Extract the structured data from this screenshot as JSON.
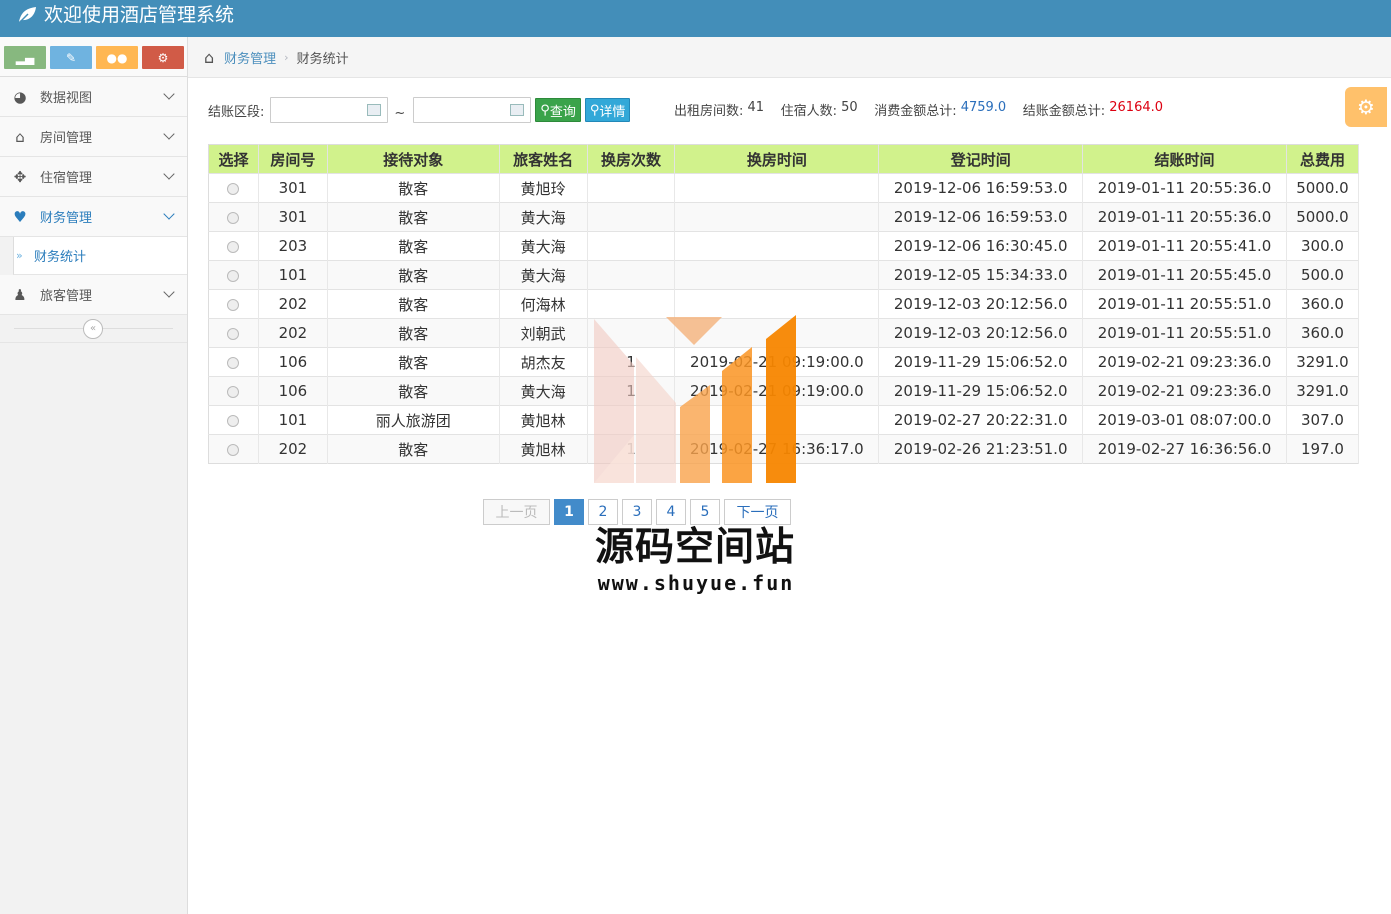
{
  "app": {
    "title": "欢迎使用酒店管理系统"
  },
  "sidebar": {
    "items": [
      {
        "label": "数据视图",
        "icon": "dashboard-icon"
      },
      {
        "label": "房间管理",
        "icon": "home-icon"
      },
      {
        "label": "住宿管理",
        "icon": "move-icon"
      },
      {
        "label": "财务管理",
        "icon": "heart-icon",
        "active": true
      },
      {
        "label": "旅客管理",
        "icon": "user-icon"
      }
    ],
    "sub_item": "财务统计"
  },
  "breadcrumb": {
    "parent": "财务管理",
    "current": "财务统计"
  },
  "filter": {
    "label": "结账区段:",
    "tilde": "~",
    "query_btn": "查询",
    "detail_btn": "详情"
  },
  "stats": {
    "rooms_label": "出租房间数: ",
    "rooms": "41",
    "guests_label": "住宿人数: ",
    "guests": "50",
    "consume_label": "消费金额总计: ",
    "consume": "4759.0",
    "checkout_label": "结账金额总计: ",
    "checkout": "26164.0"
  },
  "table": {
    "headers": [
      "选择",
      "房间号",
      "接待对象",
      "旅客姓名",
      "换房次数",
      "换房时间",
      "登记时间",
      "结账时间",
      "总费用"
    ],
    "rows": [
      [
        "301",
        "散客",
        "黄旭玲",
        "",
        "",
        "2019-12-06 16:59:53.0",
        "2019-01-11 20:55:36.0",
        "5000.0"
      ],
      [
        "301",
        "散客",
        "黄大海",
        "",
        "",
        "2019-12-06 16:59:53.0",
        "2019-01-11 20:55:36.0",
        "5000.0"
      ],
      [
        "203",
        "散客",
        "黄大海",
        "",
        "",
        "2019-12-06 16:30:45.0",
        "2019-01-11 20:55:41.0",
        "300.0"
      ],
      [
        "101",
        "散客",
        "黄大海",
        "",
        "",
        "2019-12-05 15:34:33.0",
        "2019-01-11 20:55:45.0",
        "500.0"
      ],
      [
        "202",
        "散客",
        "何海林",
        "",
        "",
        "2019-12-03 20:12:56.0",
        "2019-01-11 20:55:51.0",
        "360.0"
      ],
      [
        "202",
        "散客",
        "刘朝武",
        "",
        "",
        "2019-12-03 20:12:56.0",
        "2019-01-11 20:55:51.0",
        "360.0"
      ],
      [
        "106",
        "散客",
        "胡杰友",
        "1",
        "2019-02-21 09:19:00.0",
        "2019-11-29 15:06:52.0",
        "2019-02-21 09:23:36.0",
        "3291.0"
      ],
      [
        "106",
        "散客",
        "黄大海",
        "1",
        "2019-02-21 09:19:00.0",
        "2019-11-29 15:06:52.0",
        "2019-02-21 09:23:36.0",
        "3291.0"
      ],
      [
        "101",
        "丽人旅游团",
        "黄旭林",
        "",
        "",
        "2019-02-27 20:22:31.0",
        "2019-03-01 08:07:00.0",
        "307.0"
      ],
      [
        "202",
        "散客",
        "黄旭林",
        "1",
        "2019-02-27 16:36:17.0",
        "2019-02-26 21:23:51.0",
        "2019-02-27 16:36:56.0",
        "197.0"
      ]
    ]
  },
  "pager": {
    "prev": "上一页",
    "pages": [
      "1",
      "2",
      "3",
      "4",
      "5"
    ],
    "next": "下一页"
  },
  "watermark": {
    "title": "源码空间站",
    "url": "www.shuyue.fun"
  }
}
